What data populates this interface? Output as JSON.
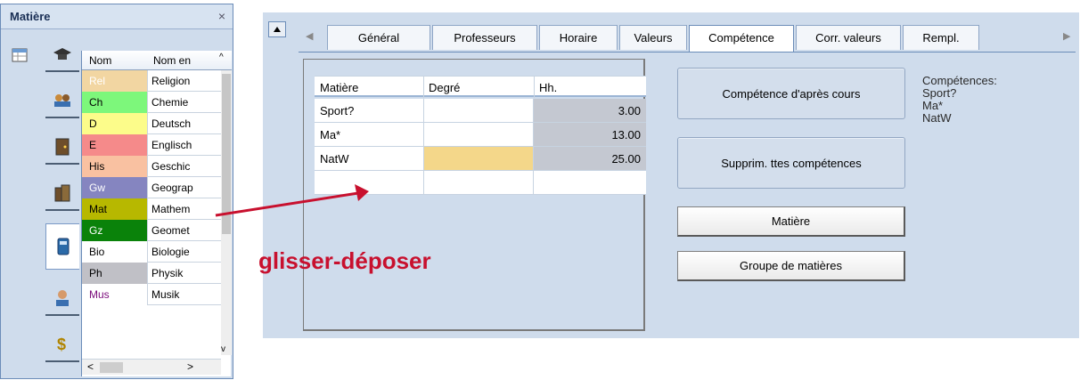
{
  "left_panel": {
    "title": "Matière",
    "close_glyph": "×",
    "columns": [
      "Nom",
      "Nom en"
    ],
    "rows": [
      {
        "code": "Rel",
        "name": "Religion",
        "bg": "#f2d6a2",
        "fg": "#ffffff"
      },
      {
        "code": "Ch",
        "name": "Chemie",
        "bg": "#7df77b",
        "fg": "#000000"
      },
      {
        "code": "D",
        "name": "Deutsch",
        "bg": "#fcfc8a",
        "fg": "#000000"
      },
      {
        "code": "E",
        "name": "Englisch",
        "bg": "#f58a8a",
        "fg": "#000000"
      },
      {
        "code": "His",
        "name": "Geschic",
        "bg": "#f9c1a1",
        "fg": "#000000"
      },
      {
        "code": "Gw",
        "name": "Geograp",
        "bg": "#8585c0",
        "fg": "#ffffff"
      },
      {
        "code": "Mat",
        "name": "Mathem",
        "bg": "#b7b800",
        "fg": "#000000"
      },
      {
        "code": "Gz",
        "name": "Geomet",
        "bg": "#0a820a",
        "fg": "#ffffff"
      },
      {
        "code": "Bio",
        "name": "Biologie",
        "bg": "#ffffff",
        "fg": "#000000"
      },
      {
        "code": "Ph",
        "name": "Physik",
        "bg": "#c0c0c6",
        "fg": "#000000"
      },
      {
        "code": "Mus",
        "name": "Musik",
        "bg": "#ffffff",
        "fg": "#7a0a7a"
      }
    ],
    "scroll_left_glyph": "<",
    "scroll_right_glyph": ">",
    "scroll_up_glyph": "^",
    "scroll_down_glyph": "v"
  },
  "right_panel": {
    "tabs": [
      "Général",
      "Professeurs",
      "Horaire",
      "Valeurs",
      "Compétence",
      "Corr. valeurs",
      "Rempl."
    ],
    "active_tab": "Compétence",
    "table": {
      "headers": [
        "Matière",
        "Degré",
        "Hh."
      ],
      "rows": [
        {
          "matiere": "Sport?",
          "degre": "",
          "hh": "3.00"
        },
        {
          "matiere": "Ma*",
          "degre": "",
          "hh": "13.00"
        },
        {
          "matiere": "NatW",
          "degre": "",
          "hh": "25.00"
        },
        {
          "matiere": "",
          "degre": "",
          "hh": ""
        }
      ]
    },
    "buttons": {
      "competence_cours": "Compétence d'après cours",
      "suppr_competences": "Supprim. ttes compétences",
      "matiere": "Matière",
      "groupe_matieres": "Groupe de matières"
    },
    "competences_title": "Compétences:",
    "competences_list": [
      "Sport?",
      "Ma*",
      "NatW"
    ]
  },
  "annotation": {
    "drag_label": "glisser-déposer",
    "color": "#c8102e"
  }
}
